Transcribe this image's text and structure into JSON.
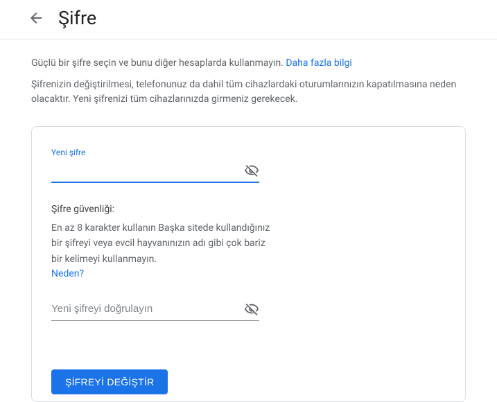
{
  "header": {
    "title": "Şifre"
  },
  "intro": {
    "text": "Güçlü bir şifre seçin ve bunu diğer hesaplarda kullanmayın. ",
    "link": "Daha fazla bilgi"
  },
  "warning": "Şifrenizin değiştirilmesi, telefonunuz da dahil tüm cihazlardaki oturumlarınızın kapatılmasına neden olacaktır. Yeni şifrenizi tüm cihazlarınızda girmeniz gerekecek.",
  "newPassword": {
    "label": "Yeni şifre",
    "value": ""
  },
  "strength": {
    "title": "Şifre güvenliği:",
    "body": "En az 8 karakter kullanın Başka sitede kullandığınız bir şifreyi veya evcil hayvanınızın adı gibi çok bariz bir kelimeyi kullanmayın.",
    "why": "Neden?"
  },
  "confirm": {
    "placeholder": "Yeni şifreyi doğrulayın",
    "value": ""
  },
  "submit": "ŞİFREYİ DEĞİŞTİR"
}
